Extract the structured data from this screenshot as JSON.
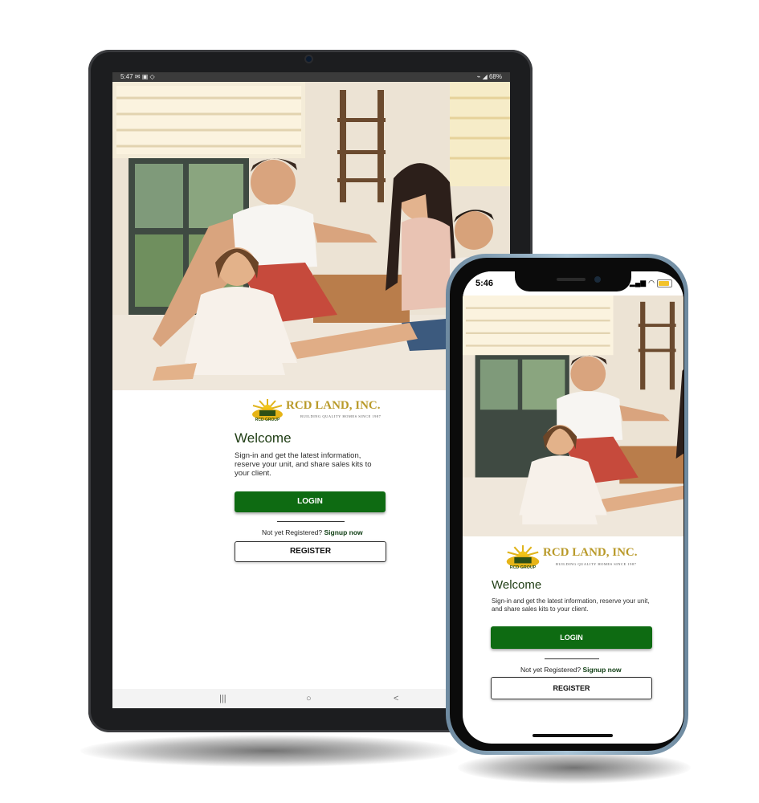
{
  "tablet": {
    "status": {
      "time": "5:47",
      "left_icons": "✉ ▣ ◇",
      "right_icons": "⌁ ◢ 68%"
    },
    "logo": {
      "name": "RCD LAND, INC.",
      "tagline": "BUILDING QUALITY HOMES SINCE 1987",
      "group": "RCD GROUP"
    },
    "welcome": "Welcome",
    "description": "Sign-in and get the latest information, reserve your unit, and share sales kits to your client.",
    "login_label": "LOGIN",
    "signup_prompt": "Not yet Registered?",
    "signup_link": "Signup now",
    "register_label": "REGISTER",
    "nav": {
      "recents": "|||",
      "home": "○",
      "back": "<"
    }
  },
  "phone": {
    "status": {
      "time": "5:46",
      "signal": "▂▄▆",
      "wifi": "◠"
    },
    "logo": {
      "name": "RCD LAND, INC.",
      "tagline": "BUILDING QUALITY HOMES SINCE 1987",
      "group": "RCD GROUP"
    },
    "welcome": "Welcome",
    "description": "Sign-in and get the latest information, reserve your unit, and share sales kits to  your client.",
    "login_label": "LOGIN",
    "signup_prompt": "Not yet Registered?",
    "signup_link": "Signup now",
    "register_label": "REGISTER"
  },
  "colors": {
    "brand_green": "#0e6b12",
    "logo_gold": "#b99a2a",
    "heading_green": "#1f3d14"
  }
}
